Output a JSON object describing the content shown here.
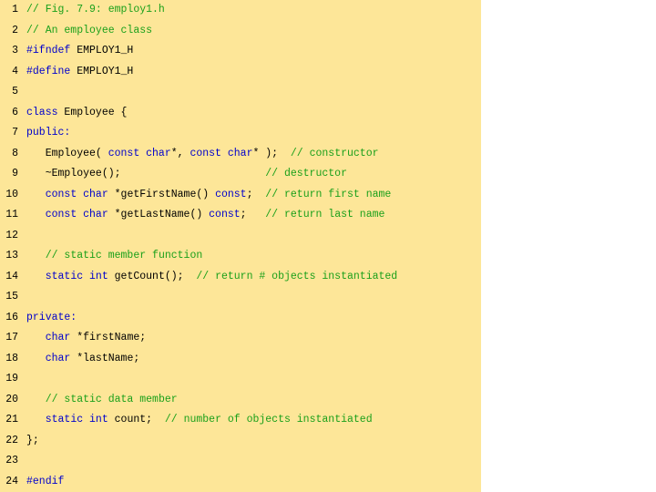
{
  "lines": [
    {
      "num": "1",
      "tokens": [
        {
          "t": "// Fig. 7.9: employ1.h",
          "c": "comment"
        }
      ]
    },
    {
      "num": "2",
      "tokens": [
        {
          "t": "// An employee class",
          "c": "comment"
        }
      ]
    },
    {
      "num": "3",
      "tokens": [
        {
          "t": "#ifndef",
          "c": "preproc"
        },
        {
          "t": " EMPLOY1_H",
          "c": "plain"
        }
      ]
    },
    {
      "num": "4",
      "tokens": [
        {
          "t": "#define",
          "c": "preproc"
        },
        {
          "t": " EMPLOY1_H",
          "c": "plain"
        }
      ]
    },
    {
      "num": "5",
      "tokens": []
    },
    {
      "num": "6",
      "tokens": [
        {
          "t": "class",
          "c": "keyword"
        },
        {
          "t": " Employee {",
          "c": "plain"
        }
      ]
    },
    {
      "num": "7",
      "tokens": [
        {
          "t": "public:",
          "c": "keyword"
        }
      ]
    },
    {
      "num": "8",
      "tokens": [
        {
          "t": "   Employee( ",
          "c": "plain"
        },
        {
          "t": "const char",
          "c": "keyword"
        },
        {
          "t": "*, ",
          "c": "plain"
        },
        {
          "t": "const char",
          "c": "keyword"
        },
        {
          "t": "* );  ",
          "c": "plain"
        },
        {
          "t": "// constructor",
          "c": "comment"
        }
      ]
    },
    {
      "num": "9",
      "tokens": [
        {
          "t": "   ~Employee();                       ",
          "c": "plain"
        },
        {
          "t": "// destructor",
          "c": "comment"
        }
      ]
    },
    {
      "num": "10",
      "tokens": [
        {
          "t": "   ",
          "c": "plain"
        },
        {
          "t": "const char",
          "c": "keyword"
        },
        {
          "t": " *getFirstName() ",
          "c": "plain"
        },
        {
          "t": "const",
          "c": "keyword"
        },
        {
          "t": ";  ",
          "c": "plain"
        },
        {
          "t": "// return first name",
          "c": "comment"
        }
      ]
    },
    {
      "num": "11",
      "tokens": [
        {
          "t": "   ",
          "c": "plain"
        },
        {
          "t": "const char",
          "c": "keyword"
        },
        {
          "t": " *getLastName() ",
          "c": "plain"
        },
        {
          "t": "const",
          "c": "keyword"
        },
        {
          "t": ";   ",
          "c": "plain"
        },
        {
          "t": "// return last name",
          "c": "comment"
        }
      ]
    },
    {
      "num": "12",
      "tokens": []
    },
    {
      "num": "13",
      "tokens": [
        {
          "t": "   ",
          "c": "plain"
        },
        {
          "t": "// static member function",
          "c": "comment"
        }
      ]
    },
    {
      "num": "14",
      "tokens": [
        {
          "t": "   ",
          "c": "plain"
        },
        {
          "t": "static int",
          "c": "keyword"
        },
        {
          "t": " getCount();  ",
          "c": "plain"
        },
        {
          "t": "// return # objects instantiated",
          "c": "comment"
        }
      ]
    },
    {
      "num": "15",
      "tokens": []
    },
    {
      "num": "16",
      "tokens": [
        {
          "t": "private:",
          "c": "keyword"
        }
      ]
    },
    {
      "num": "17",
      "tokens": [
        {
          "t": "   ",
          "c": "plain"
        },
        {
          "t": "char",
          "c": "keyword"
        },
        {
          "t": " *firstName;",
          "c": "plain"
        }
      ]
    },
    {
      "num": "18",
      "tokens": [
        {
          "t": "   ",
          "c": "plain"
        },
        {
          "t": "char",
          "c": "keyword"
        },
        {
          "t": " *lastName;",
          "c": "plain"
        }
      ]
    },
    {
      "num": "19",
      "tokens": []
    },
    {
      "num": "20",
      "tokens": [
        {
          "t": "   ",
          "c": "plain"
        },
        {
          "t": "// static data member",
          "c": "comment"
        }
      ]
    },
    {
      "num": "21",
      "tokens": [
        {
          "t": "   ",
          "c": "plain"
        },
        {
          "t": "static int",
          "c": "keyword"
        },
        {
          "t": " count;  ",
          "c": "plain"
        },
        {
          "t": "// number of objects instantiated",
          "c": "comment"
        }
      ]
    },
    {
      "num": "22",
      "tokens": [
        {
          "t": "};",
          "c": "plain"
        }
      ]
    },
    {
      "num": "23",
      "tokens": []
    },
    {
      "num": "24",
      "tokens": [
        {
          "t": "#endif",
          "c": "preproc"
        }
      ]
    }
  ],
  "colors": {
    "panel_background": "#fde698",
    "keyword": "#0000cc",
    "comment": "#1aa01a",
    "plain": "#000000"
  }
}
